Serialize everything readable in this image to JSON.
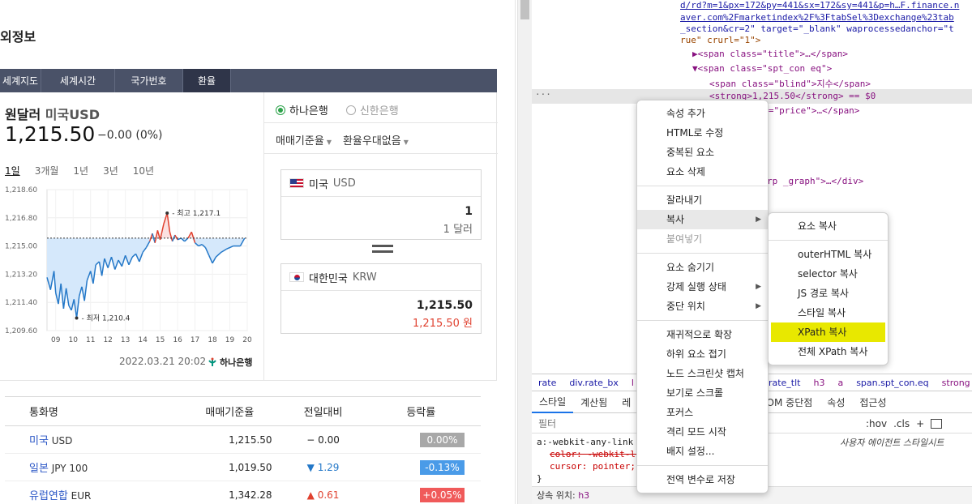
{
  "page": {
    "heading": "외정보",
    "tabs": [
      {
        "label": "세계지도"
      },
      {
        "label": "세계시간"
      },
      {
        "label": "국가번호"
      },
      {
        "label": "환율"
      }
    ],
    "currency": {
      "title_main": "원달러",
      "title_sub": "미국USD",
      "current_value": "1,215.50",
      "change": "−0.00 (0%)"
    },
    "periods": [
      "1일",
      "3개월",
      "1년",
      "3년",
      "10년"
    ],
    "bank_options": [
      {
        "label": "하나은행",
        "selected": true
      },
      {
        "label": "신한은행",
        "selected": false
      }
    ],
    "rate_options": {
      "base": "매매기준율",
      "preference": "환율우대없음"
    },
    "from_box": {
      "country": "미국",
      "code": "USD",
      "amount": "1",
      "amount_text": "1 달러"
    },
    "to_box": {
      "country": "대한민국",
      "code": "KRW",
      "amount": "1,215.50",
      "amount_text": "1,215.50 원"
    },
    "chart_date": "2022.03.21 20:02",
    "chart_bank": "하나은행",
    "table": {
      "headers": [
        "통화명",
        "매매기준율",
        "전일대비",
        "등락률"
      ],
      "rows": [
        {
          "name": "미국",
          "code": "USD",
          "rate": "1,215.50",
          "diff": "− 0.00",
          "dir": "flat",
          "pct": "0.00%"
        },
        {
          "name": "일본",
          "code": "JPY 100",
          "rate": "1,019.50",
          "diff": "▼ 1.29",
          "dir": "down",
          "pct": "-0.13%"
        },
        {
          "name": "유럽연합",
          "code": "EUR",
          "rate": "1,342.28",
          "diff": "▲ 0.61",
          "dir": "up",
          "pct": "+0.05%"
        }
      ]
    }
  },
  "chart_data": {
    "type": "line",
    "title": "",
    "xlabel": "",
    "ylabel": "",
    "x_ticks": [
      "09",
      "10",
      "11",
      "12",
      "13",
      "14",
      "15",
      "16",
      "17",
      "18",
      "19",
      "20"
    ],
    "y_ticks": [
      "1,218.60",
      "1,216.80",
      "1,215.00",
      "1,213.20",
      "1,211.40",
      "1,209.60"
    ],
    "ylim": [
      1209.6,
      1218.6
    ],
    "xlim": [
      8.5,
      20
    ],
    "baseline": 1215.5,
    "high_label": "최고 1,217.1",
    "low_label": "최저 1,210.4",
    "high": {
      "x": 15.4,
      "y": 1217.1
    },
    "low": {
      "x": 10.2,
      "y": 1210.4
    },
    "series": [
      {
        "points": [
          [
            8.5,
            1213.0
          ],
          [
            8.7,
            1212.2
          ],
          [
            8.9,
            1213.4
          ],
          [
            9.0,
            1212.0
          ],
          [
            9.15,
            1211.3
          ],
          [
            9.3,
            1212.6
          ],
          [
            9.45,
            1211.0
          ],
          [
            9.6,
            1212.3
          ],
          [
            9.75,
            1211.2
          ],
          [
            9.9,
            1210.9
          ],
          [
            10.05,
            1211.6
          ],
          [
            10.2,
            1210.4
          ],
          [
            10.35,
            1211.8
          ],
          [
            10.5,
            1212.4
          ],
          [
            10.65,
            1211.5
          ],
          [
            10.8,
            1212.8
          ],
          [
            11.0,
            1213.4
          ],
          [
            11.15,
            1212.6
          ],
          [
            11.3,
            1213.8
          ],
          [
            11.5,
            1214.0
          ],
          [
            11.65,
            1213.1
          ],
          [
            11.8,
            1214.2
          ],
          [
            12.0,
            1213.6
          ],
          [
            12.2,
            1214.3
          ],
          [
            12.4,
            1213.5
          ],
          [
            12.6,
            1214.1
          ],
          [
            12.8,
            1213.7
          ],
          [
            13.0,
            1214.4
          ],
          [
            13.2,
            1213.8
          ],
          [
            13.4,
            1214.3
          ],
          [
            13.6,
            1214.5
          ],
          [
            13.8,
            1214.0
          ],
          [
            14.0,
            1214.6
          ],
          [
            14.2,
            1214.9
          ],
          [
            14.4,
            1215.3
          ],
          [
            14.55,
            1215.8
          ],
          [
            14.7,
            1215.2
          ],
          [
            14.85,
            1216.0
          ],
          [
            15.0,
            1215.4
          ],
          [
            15.2,
            1216.4
          ],
          [
            15.4,
            1217.1
          ],
          [
            15.55,
            1215.9
          ],
          [
            15.7,
            1215.3
          ],
          [
            15.85,
            1215.7
          ],
          [
            16.0,
            1215.4
          ],
          [
            16.2,
            1215.5
          ],
          [
            16.4,
            1215.3
          ],
          [
            16.6,
            1215.5
          ],
          [
            16.8,
            1215.9
          ],
          [
            17.0,
            1215.2
          ],
          [
            17.2,
            1215.0
          ],
          [
            17.4,
            1215.1
          ],
          [
            17.6,
            1214.9
          ],
          [
            17.8,
            1214.4
          ],
          [
            18.0,
            1213.9
          ],
          [
            18.2,
            1214.3
          ],
          [
            18.5,
            1214.6
          ],
          [
            18.8,
            1214.8
          ],
          [
            19.2,
            1215.0
          ],
          [
            19.6,
            1215.0
          ],
          [
            19.85,
            1215.5
          ]
        ]
      }
    ]
  },
  "devtools": {
    "lines": [
      {
        "text": "d/rd?m=1&px=172&py=441&sx=172&sy=441&p=h…F.finance.n"
      },
      {
        "text": "aver.com%2Fmarketindex%2F%3FtabSel%3Dexchange%23tab"
      },
      {
        "text": "_section&cr=2\" target=\"_blank\" waprocessedanchor=\"t"
      },
      {
        "text": "rue\" crurl=\"1\">"
      },
      {
        "text": "▶<span class=\"title\">…</span>"
      },
      {
        "text": "▼<span class=\"spt_con eq\">"
      },
      {
        "text": "<span class=\"blind\">지수</span>"
      },
      {
        "text": "<strong>1,215.50</strong> == $0"
      },
      {
        "text": "<span class=\"price\">…</span>"
      },
      {
        "text": "rp _graph\">…</div>"
      }
    ],
    "breadcrumbs": [
      "rate",
      "div.rate_bx",
      "l",
      "rate_tlt",
      "h3",
      "a",
      "span.spt_con.eq",
      "strong"
    ],
    "style_tabs": [
      "스타일",
      "계산됨",
      "레",
      "DOM 중단점",
      "속성",
      "접근성"
    ],
    "filter_placeholder": "필터",
    "filter_tools": [
      ":hov",
      ".cls",
      "+"
    ],
    "style_rule": {
      "selector": "a:-webkit-any-link",
      "props": [
        "color: -webkit-link;",
        "cursor: pointer;"
      ]
    },
    "ua_label": "사용자 에이전트 스타일시트",
    "inherit_label": "상속 위치:",
    "inherit_tag": "h3",
    "context_menu": [
      {
        "label": "속성 추가"
      },
      {
        "label": "HTML로 수정"
      },
      {
        "label": "중복된 요소"
      },
      {
        "label": "요소 삭제"
      },
      {
        "label": "잘라내기"
      },
      {
        "label": "복사"
      },
      {
        "label": "붙여넣기"
      },
      {
        "label": "요소 숨기기"
      },
      {
        "label": "강제 실행 상태"
      },
      {
        "label": "중단 위치"
      },
      {
        "label": "재귀적으로 확장"
      },
      {
        "label": "하위 요소 접기"
      },
      {
        "label": "노드 스크린샷 캡처"
      },
      {
        "label": "보기로 스크롤"
      },
      {
        "label": "포커스"
      },
      {
        "label": "격리 모드 시작"
      },
      {
        "label": "배지 설정..."
      },
      {
        "label": "전역 변수로 저장"
      }
    ],
    "copy_submenu": [
      {
        "label": "요소 복사"
      },
      {
        "label": "outerHTML 복사"
      },
      {
        "label": "selector 복사"
      },
      {
        "label": "JS 경로 복사"
      },
      {
        "label": "스타일 복사"
      },
      {
        "label": "XPath 복사"
      },
      {
        "label": "전체 XPath 복사"
      }
    ],
    "colors": {
      "highlight": "#e8e800",
      "selected_line": "#e6e6e6"
    }
  }
}
